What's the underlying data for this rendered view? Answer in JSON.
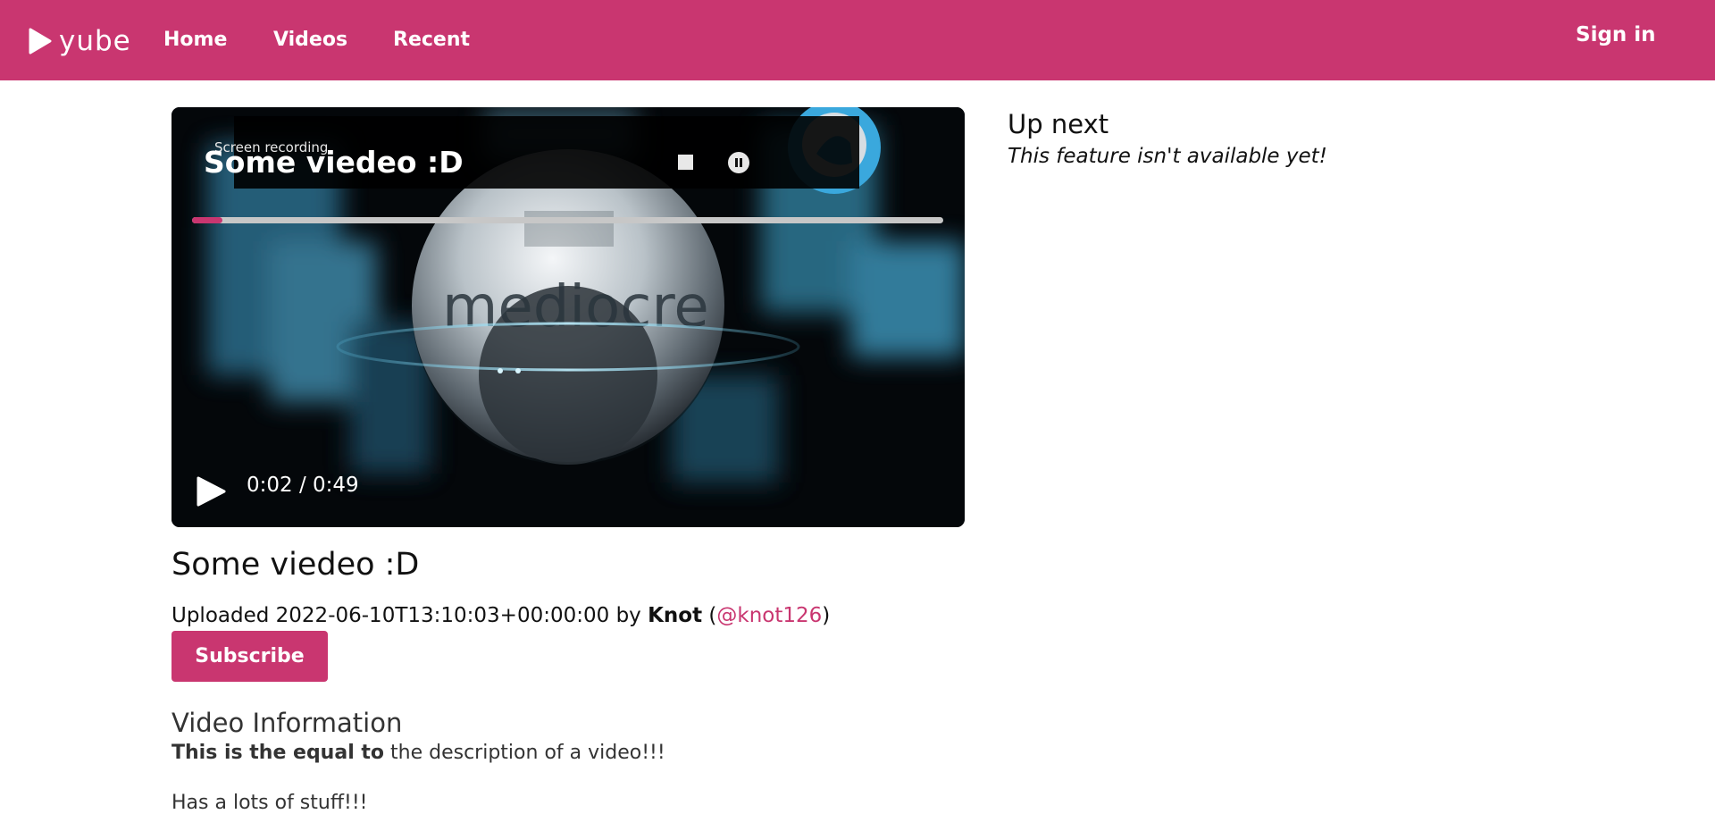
{
  "nav": {
    "logo_text": "yube",
    "links": [
      "Home",
      "Videos",
      "Recent"
    ],
    "sign_in": "Sign in"
  },
  "player": {
    "recording_label": "Screen recording",
    "overlay_title": "Some viedeo :D",
    "time": "0:02 / 0:49",
    "progress_fraction": 0.04,
    "scene_text": "mediocre"
  },
  "video": {
    "title": "Some viedeo :D",
    "uploaded_prefix": "Uploaded",
    "timestamp": "2022-06-10T13:10:03+00:00:00",
    "by": "by",
    "author": "Knot",
    "handle": "@knot126",
    "subscribe_label": "Subscribe",
    "info_heading": "Video Information",
    "description_bold": "This is the equal to",
    "description_rest": "the description of a video!!!",
    "description_line2": "Has a lots of stuff!!!"
  },
  "sidebar": {
    "heading": "Up next",
    "message": "This feature isn't available yet!"
  },
  "colors": {
    "brand": "#c93670",
    "white": "#ffffff"
  }
}
